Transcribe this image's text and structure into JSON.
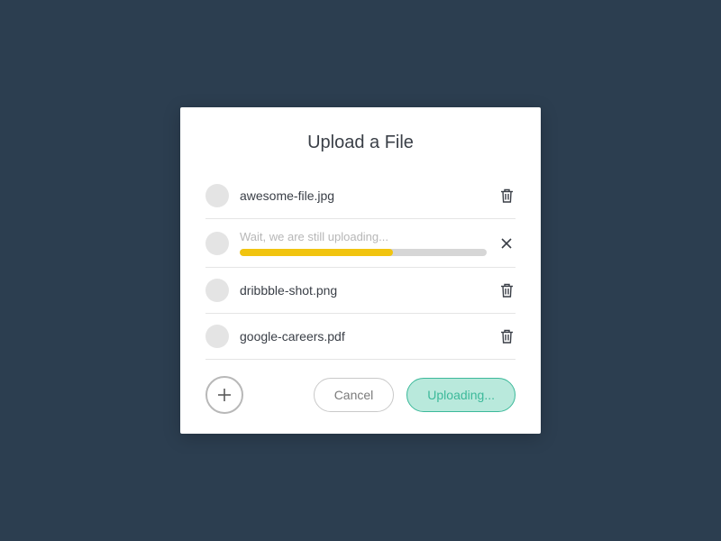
{
  "dialog": {
    "title": "Upload a File",
    "files": [
      {
        "name": "awesome-file.jpg",
        "status": "done"
      },
      {
        "name": "Wait, we are still uploading...",
        "status": "uploading",
        "progress": 62
      },
      {
        "name": "dribbble-shot.png",
        "status": "done"
      },
      {
        "name": "google-careers.pdf",
        "status": "done"
      }
    ],
    "buttons": {
      "cancel": "Cancel",
      "primary": "Uploading..."
    },
    "colors": {
      "background": "#2c3e50",
      "accent": "#3cb99a",
      "accentFill": "#b9e9dc",
      "progress": "#f1c40f"
    }
  }
}
